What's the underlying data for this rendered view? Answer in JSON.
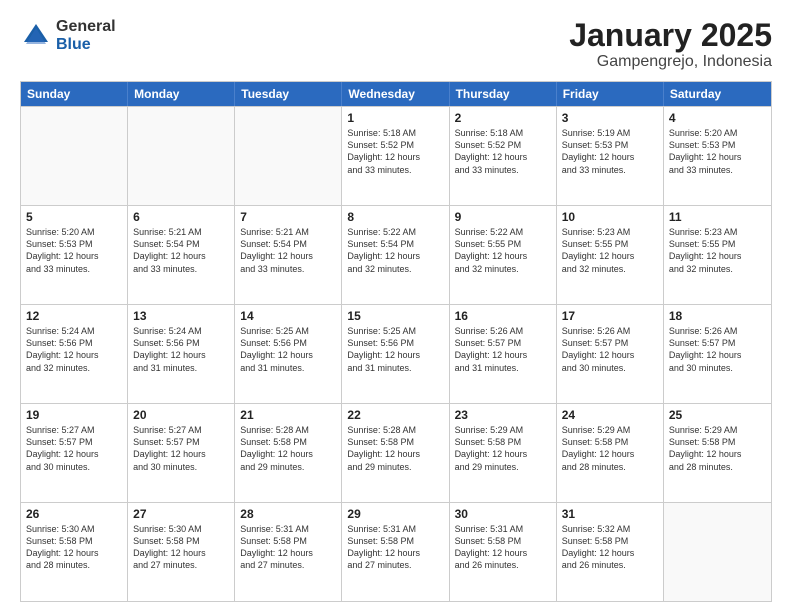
{
  "logo": {
    "general": "General",
    "blue": "Blue"
  },
  "title": "January 2025",
  "location": "Gampengrejo, Indonesia",
  "days": [
    "Sunday",
    "Monday",
    "Tuesday",
    "Wednesday",
    "Thursday",
    "Friday",
    "Saturday"
  ],
  "rows": [
    [
      {
        "day": "",
        "text": "",
        "empty": true
      },
      {
        "day": "",
        "text": "",
        "empty": true
      },
      {
        "day": "",
        "text": "",
        "empty": true
      },
      {
        "day": "1",
        "text": "Sunrise: 5:18 AM\nSunset: 5:52 PM\nDaylight: 12 hours\nand 33 minutes.",
        "empty": false
      },
      {
        "day": "2",
        "text": "Sunrise: 5:18 AM\nSunset: 5:52 PM\nDaylight: 12 hours\nand 33 minutes.",
        "empty": false
      },
      {
        "day": "3",
        "text": "Sunrise: 5:19 AM\nSunset: 5:53 PM\nDaylight: 12 hours\nand 33 minutes.",
        "empty": false
      },
      {
        "day": "4",
        "text": "Sunrise: 5:20 AM\nSunset: 5:53 PM\nDaylight: 12 hours\nand 33 minutes.",
        "empty": false
      }
    ],
    [
      {
        "day": "5",
        "text": "Sunrise: 5:20 AM\nSunset: 5:53 PM\nDaylight: 12 hours\nand 33 minutes.",
        "empty": false
      },
      {
        "day": "6",
        "text": "Sunrise: 5:21 AM\nSunset: 5:54 PM\nDaylight: 12 hours\nand 33 minutes.",
        "empty": false
      },
      {
        "day": "7",
        "text": "Sunrise: 5:21 AM\nSunset: 5:54 PM\nDaylight: 12 hours\nand 33 minutes.",
        "empty": false
      },
      {
        "day": "8",
        "text": "Sunrise: 5:22 AM\nSunset: 5:54 PM\nDaylight: 12 hours\nand 32 minutes.",
        "empty": false
      },
      {
        "day": "9",
        "text": "Sunrise: 5:22 AM\nSunset: 5:55 PM\nDaylight: 12 hours\nand 32 minutes.",
        "empty": false
      },
      {
        "day": "10",
        "text": "Sunrise: 5:23 AM\nSunset: 5:55 PM\nDaylight: 12 hours\nand 32 minutes.",
        "empty": false
      },
      {
        "day": "11",
        "text": "Sunrise: 5:23 AM\nSunset: 5:55 PM\nDaylight: 12 hours\nand 32 minutes.",
        "empty": false
      }
    ],
    [
      {
        "day": "12",
        "text": "Sunrise: 5:24 AM\nSunset: 5:56 PM\nDaylight: 12 hours\nand 32 minutes.",
        "empty": false
      },
      {
        "day": "13",
        "text": "Sunrise: 5:24 AM\nSunset: 5:56 PM\nDaylight: 12 hours\nand 31 minutes.",
        "empty": false
      },
      {
        "day": "14",
        "text": "Sunrise: 5:25 AM\nSunset: 5:56 PM\nDaylight: 12 hours\nand 31 minutes.",
        "empty": false
      },
      {
        "day": "15",
        "text": "Sunrise: 5:25 AM\nSunset: 5:56 PM\nDaylight: 12 hours\nand 31 minutes.",
        "empty": false
      },
      {
        "day": "16",
        "text": "Sunrise: 5:26 AM\nSunset: 5:57 PM\nDaylight: 12 hours\nand 31 minutes.",
        "empty": false
      },
      {
        "day": "17",
        "text": "Sunrise: 5:26 AM\nSunset: 5:57 PM\nDaylight: 12 hours\nand 30 minutes.",
        "empty": false
      },
      {
        "day": "18",
        "text": "Sunrise: 5:26 AM\nSunset: 5:57 PM\nDaylight: 12 hours\nand 30 minutes.",
        "empty": false
      }
    ],
    [
      {
        "day": "19",
        "text": "Sunrise: 5:27 AM\nSunset: 5:57 PM\nDaylight: 12 hours\nand 30 minutes.",
        "empty": false
      },
      {
        "day": "20",
        "text": "Sunrise: 5:27 AM\nSunset: 5:57 PM\nDaylight: 12 hours\nand 30 minutes.",
        "empty": false
      },
      {
        "day": "21",
        "text": "Sunrise: 5:28 AM\nSunset: 5:58 PM\nDaylight: 12 hours\nand 29 minutes.",
        "empty": false
      },
      {
        "day": "22",
        "text": "Sunrise: 5:28 AM\nSunset: 5:58 PM\nDaylight: 12 hours\nand 29 minutes.",
        "empty": false
      },
      {
        "day": "23",
        "text": "Sunrise: 5:29 AM\nSunset: 5:58 PM\nDaylight: 12 hours\nand 29 minutes.",
        "empty": false
      },
      {
        "day": "24",
        "text": "Sunrise: 5:29 AM\nSunset: 5:58 PM\nDaylight: 12 hours\nand 28 minutes.",
        "empty": false
      },
      {
        "day": "25",
        "text": "Sunrise: 5:29 AM\nSunset: 5:58 PM\nDaylight: 12 hours\nand 28 minutes.",
        "empty": false
      }
    ],
    [
      {
        "day": "26",
        "text": "Sunrise: 5:30 AM\nSunset: 5:58 PM\nDaylight: 12 hours\nand 28 minutes.",
        "empty": false
      },
      {
        "day": "27",
        "text": "Sunrise: 5:30 AM\nSunset: 5:58 PM\nDaylight: 12 hours\nand 27 minutes.",
        "empty": false
      },
      {
        "day": "28",
        "text": "Sunrise: 5:31 AM\nSunset: 5:58 PM\nDaylight: 12 hours\nand 27 minutes.",
        "empty": false
      },
      {
        "day": "29",
        "text": "Sunrise: 5:31 AM\nSunset: 5:58 PM\nDaylight: 12 hours\nand 27 minutes.",
        "empty": false
      },
      {
        "day": "30",
        "text": "Sunrise: 5:31 AM\nSunset: 5:58 PM\nDaylight: 12 hours\nand 26 minutes.",
        "empty": false
      },
      {
        "day": "31",
        "text": "Sunrise: 5:32 AM\nSunset: 5:58 PM\nDaylight: 12 hours\nand 26 minutes.",
        "empty": false
      },
      {
        "day": "",
        "text": "",
        "empty": true
      }
    ]
  ]
}
